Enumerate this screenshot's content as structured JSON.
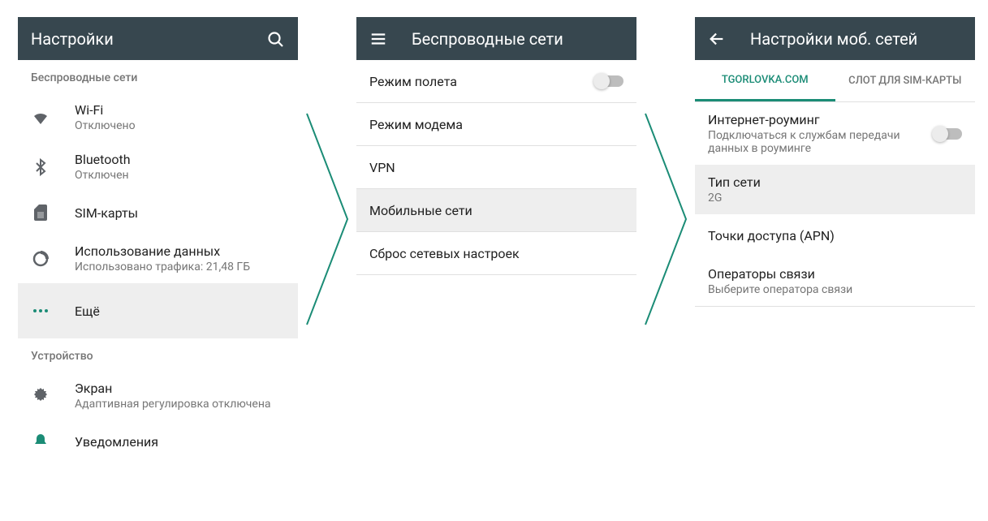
{
  "panel1": {
    "title": "Настройки",
    "sections": {
      "wireless_header": "Беспроводные сети",
      "device_header": "Устройство"
    },
    "items": {
      "wifi": {
        "label": "Wi-Fi",
        "sub": "Отключено"
      },
      "bluetooth": {
        "label": "Bluetooth",
        "sub": "Отключен"
      },
      "sim": {
        "label": "SIM-карты"
      },
      "data": {
        "label": "Использование данных",
        "sub": "Использовано трафика: 21,48 ГБ"
      },
      "more": {
        "label": "Ещё"
      },
      "display": {
        "label": "Экран",
        "sub": "Адаптивная регулировка отключена"
      },
      "notify": {
        "label": "Уведомления"
      }
    }
  },
  "panel2": {
    "title": "Беспроводные сети",
    "items": {
      "airplane": "Режим полета",
      "tether": "Режим модема",
      "vpn": "VPN",
      "mobile": "Мобильные сети",
      "reset": "Сброс сетевых настроек"
    }
  },
  "panel3": {
    "title": "Настройки моб. сетей",
    "tabs": {
      "a": "TGORLOVKA.COM",
      "b": "СЛОТ ДЛЯ SIM-КАРТЫ"
    },
    "items": {
      "roaming": {
        "label": "Интернет-роуминг",
        "sub": "Подключаться к службам передачи данных в роуминге"
      },
      "nettype": {
        "label": "Тип сети",
        "sub": "2G"
      },
      "apn": {
        "label": "Точки доступа (APN)"
      },
      "operators": {
        "label": "Операторы связи",
        "sub": "Выберите оператора связи"
      }
    }
  },
  "colors": {
    "accent": "#1b8c76"
  }
}
